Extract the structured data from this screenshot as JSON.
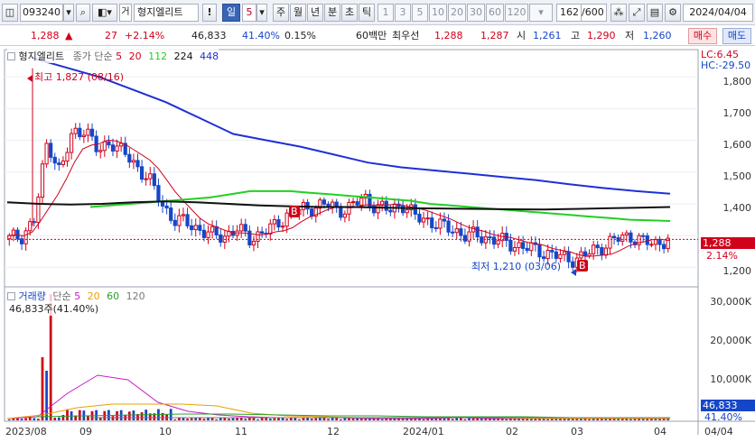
{
  "toolbar": {
    "code": "093240",
    "pre": "거",
    "stock_name": "형지엘리트",
    "warn": "!",
    "period_day": "일",
    "period_num": "5",
    "periods": [
      "주",
      "월",
      "년",
      "분",
      "초",
      "틱"
    ],
    "intervals": [
      "1",
      "3",
      "5",
      "10",
      "20",
      "30",
      "60",
      "120"
    ],
    "count": "162",
    "total": "/600",
    "date": "2024/04/04"
  },
  "quote": {
    "price": "1,288",
    "change_arrow": "▲",
    "change": "27",
    "change_pct": "+2.14%",
    "volume": "46,833",
    "vol_ratio": "41.40%",
    "turnover": "0.15%",
    "bid_label": "60백만",
    "best_label": "최우선",
    "ask_price": "1,288",
    "bid_price": "1,287",
    "open_label": "시",
    "open": "1,261",
    "high_label": "고",
    "high": "1,290",
    "low_label": "저",
    "low": "1,260",
    "buy": "매수",
    "sell": "매도"
  },
  "colors": {
    "up": "#d0021b",
    "down": "#1646c8",
    "ma5": "#d0021b",
    "ma20": "#d0021b",
    "ma112": "#22d022",
    "ma224": "#111111",
    "ma448": "#1f2fd6",
    "vol5": "#c81ec8",
    "vol20": "#e8a100",
    "vol60": "#2aa02a",
    "vol120": "#7a7a7a"
  },
  "price_legend": {
    "name": "형지엘리트",
    "type": "종가 단순",
    "ma": [
      "5",
      "20",
      "112",
      "224",
      "448"
    ]
  },
  "price_labels": {
    "lc": "LC:6.45",
    "hc": "HC:-29.50",
    "high": "최고 1,827 (08/16)",
    "low": "최저 1,210 (03/06)",
    "last": "1,288",
    "last_pct": "2.14%",
    "marker_b": "B"
  },
  "volume_legend": {
    "name": "거래량",
    "type": "단순",
    "ma": [
      "5",
      "20",
      "60",
      "120"
    ],
    "current": "46,833주(41.40%)"
  },
  "volume_labels": {
    "last": "46,833",
    "last_pct": "41.40%"
  },
  "chart_data": [
    {
      "type": "candlestick",
      "title": "형지엘리트",
      "ylim": [
        1150,
        1880
      ],
      "yticks": [
        "1,800",
        "1,700",
        "1,600",
        "1,500",
        "1,400",
        "1,300",
        "1,200"
      ],
      "xticks": [
        "2023/08",
        "09",
        "10",
        "11",
        "12",
        "2024/01",
        "02",
        "03",
        "04"
      ],
      "approx_close": [
        1290,
        1300,
        1350,
        1600,
        1500,
        1620,
        1640,
        1560,
        1600,
        1560,
        1520,
        1480,
        1400,
        1350,
        1340,
        1320,
        1300,
        1300,
        1320,
        1290,
        1310,
        1330,
        1370,
        1380,
        1390,
        1400,
        1380,
        1390,
        1420,
        1390,
        1380,
        1400,
        1360,
        1350,
        1330,
        1320,
        1300,
        1300,
        1290,
        1280,
        1270,
        1260,
        1250,
        1240,
        1225,
        1230,
        1250,
        1270,
        1290,
        1300,
        1280,
        1275,
        1288
      ],
      "ma112": [
        1390,
        1395,
        1400,
        1405,
        1410,
        1415,
        1420,
        1430,
        1440,
        1440,
        1440,
        1435,
        1430,
        1425,
        1420,
        1415,
        1410,
        1400,
        1395,
        1390,
        1385,
        1380,
        1375,
        1370,
        1365,
        1360,
        1355,
        1350,
        1348,
        1346
      ],
      "ma224": [
        1405,
        1400,
        1398,
        1400,
        1405,
        1408,
        1405,
        1400,
        1395,
        1392,
        1390,
        1390,
        1388,
        1386,
        1385,
        1384,
        1383,
        1382,
        1384,
        1386,
        1388,
        1390
      ],
      "ma448": [
        1860,
        1830,
        1800,
        1760,
        1720,
        1670,
        1620,
        1600,
        1580,
        1555,
        1530,
        1515,
        1505,
        1495,
        1485,
        1475,
        1462,
        1450,
        1440,
        1432
      ]
    },
    {
      "type": "bar",
      "title": "거래량",
      "yticks": [
        "30,000K",
        "20,000K",
        "10,000K"
      ],
      "xticks": [
        "2023/08",
        "09",
        "10",
        "11",
        "12",
        "2024/01",
        "02",
        "03",
        "04"
      ]
    }
  ]
}
